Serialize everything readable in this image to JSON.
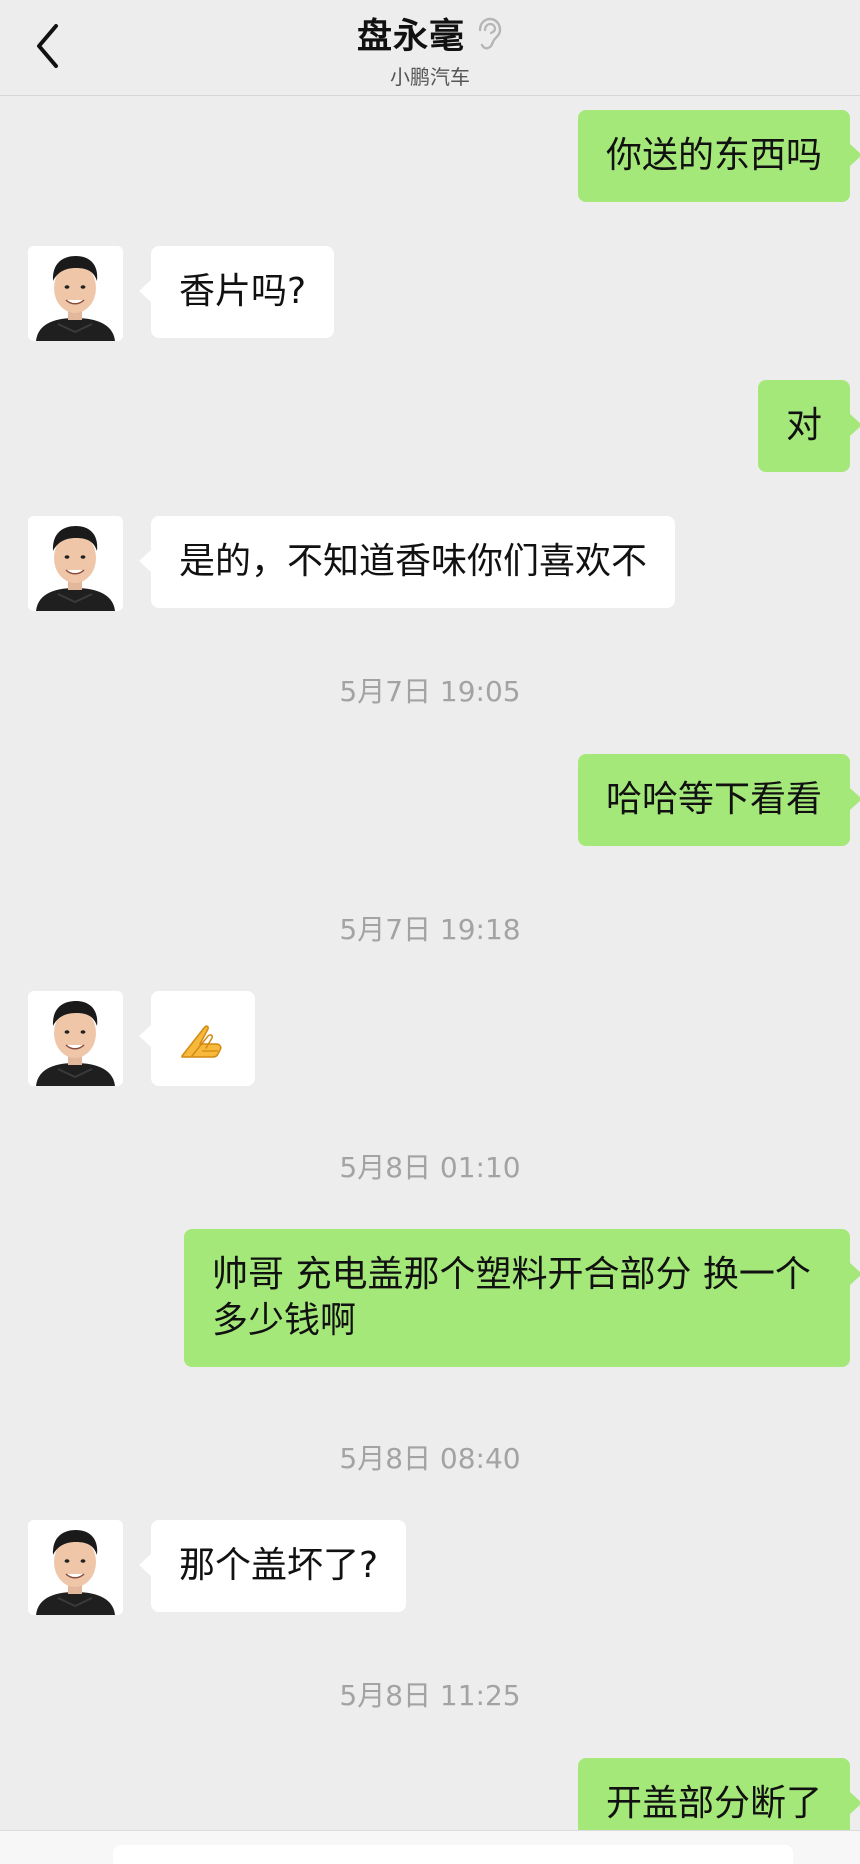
{
  "header": {
    "title": "盘永毫",
    "subtitle": "小鹏汽车",
    "back_icon": "chevron-left-icon",
    "ear_icon": "ear-icon"
  },
  "colors": {
    "background": "#ededed",
    "outgoing_bubble": "#a5e87a",
    "incoming_bubble": "#ffffff",
    "timestamp": "#a3a3a3"
  },
  "messages": [
    {
      "side": "out",
      "text": "你送的东西吗"
    },
    {
      "side": "in",
      "text": "香片吗?"
    },
    {
      "side": "out",
      "text": "对"
    },
    {
      "side": "in",
      "text": "是的，不知道香味你们喜欢不"
    },
    {
      "time": "5月7日 19:05"
    },
    {
      "side": "out",
      "text": "哈哈等下看看"
    },
    {
      "time": "5月7日 19:18"
    },
    {
      "side": "in",
      "emoji": "praying-hands-emoji"
    },
    {
      "time": "5月8日 01:10"
    },
    {
      "side": "out",
      "text": "帅哥 充电盖那个塑料开合部分 换一个多少钱啊"
    },
    {
      "time": "5月8日 08:40"
    },
    {
      "side": "in",
      "text": "那个盖坏了?"
    },
    {
      "time": "5月8日 11:25"
    },
    {
      "side": "out",
      "text": "开盖部分断了"
    }
  ]
}
